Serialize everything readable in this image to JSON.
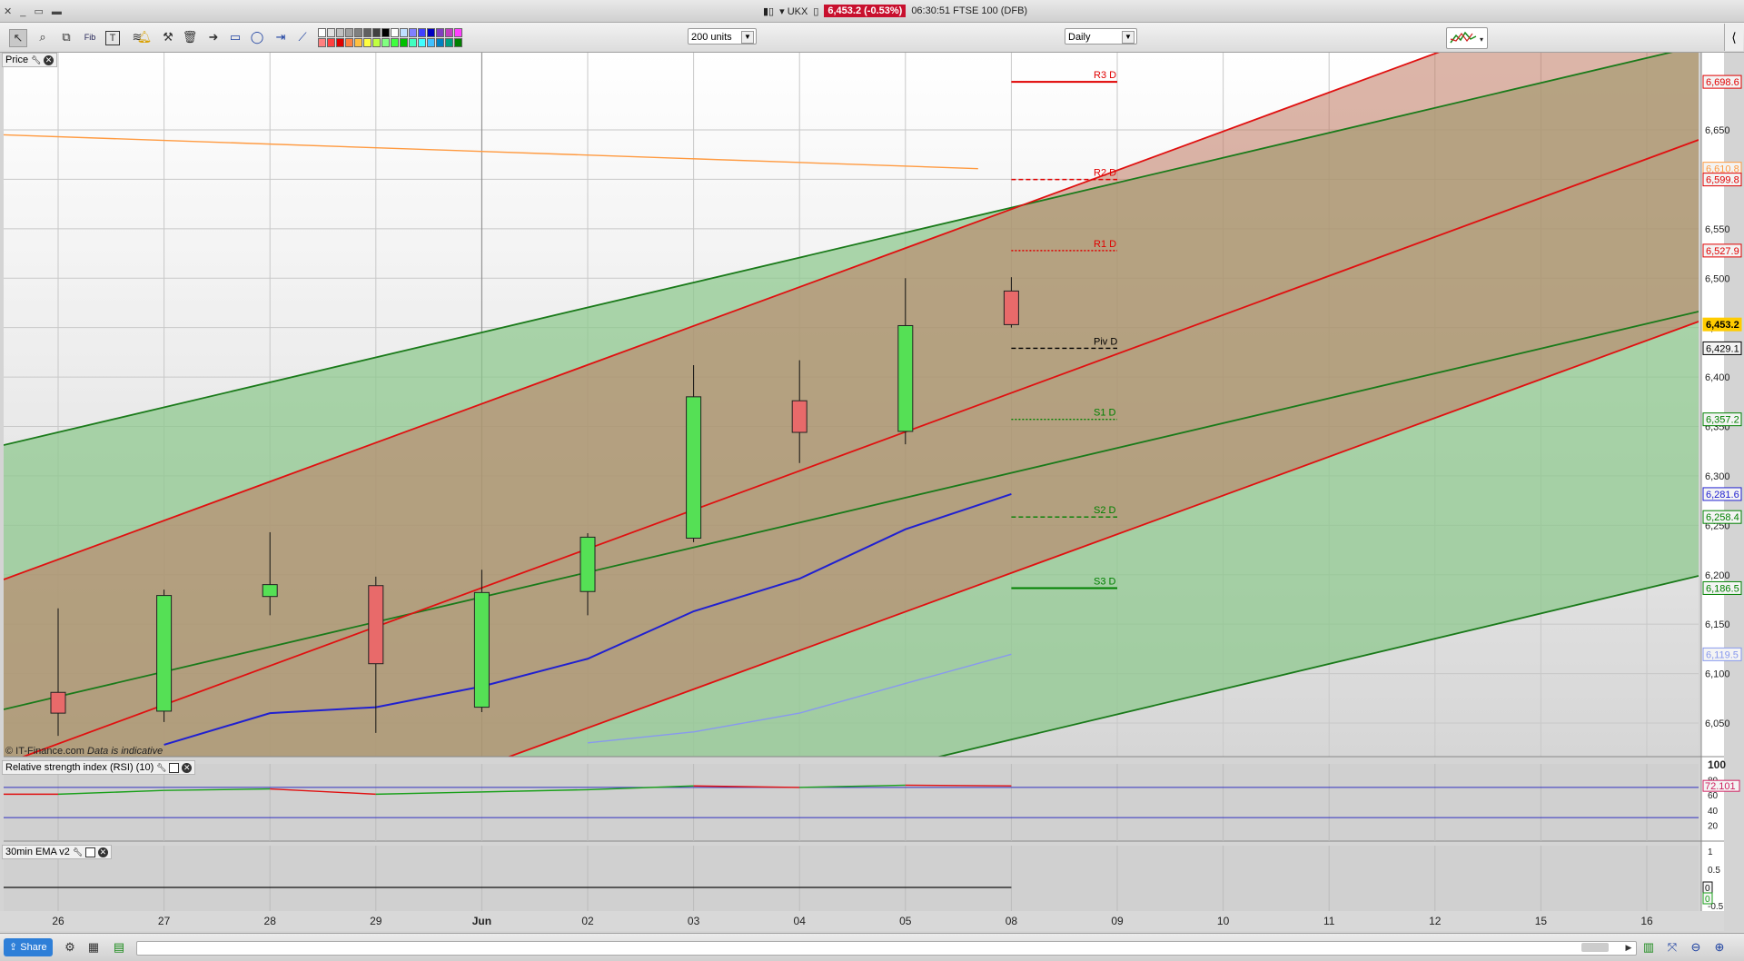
{
  "titlebar": {
    "symbol": "UKX",
    "price_badge": "6,453.2 (-0.53%)",
    "time_instrument": "06:30:51 FTSE 100 (DFB)"
  },
  "toolbar": {
    "units_select": "200 units",
    "interval_select": "Daily",
    "icons": [
      "pointer-icon",
      "zoom-icon",
      "indicator-icon",
      "fib-icon",
      "text-icon",
      "fib-retracement-icon",
      "alert-bell-icon",
      "magic-wand-icon",
      "trash-icon",
      "arrow-icon",
      "rectangle-icon",
      "ellipse-icon",
      "hline-icon",
      "trendline-icon"
    ],
    "swatch_colors": [
      "#ffffff",
      "#e0e0e0",
      "#c0c0c0",
      "#a0a0a0",
      "#808080",
      "#606060",
      "#404040",
      "#000000",
      "#ffffff",
      "#c0e0ff",
      "#8080ff",
      "#4040ff",
      "#0000c0",
      "#8040c0",
      "#c040c0",
      "#ff40ff",
      "#ff8080",
      "#ff4040",
      "#e00000",
      "#ff8040",
      "#ffc040",
      "#ffff40",
      "#c0ff40",
      "#80ff80",
      "#40ff40",
      "#00c000",
      "#40ffc0",
      "#40ffff",
      "#40c0ff",
      "#0080c0",
      "#00a080",
      "#008000"
    ]
  },
  "panels": {
    "price_label": "Price",
    "rsi_label": "Relative strength index (RSI) (10)",
    "ema_label": "30min EMA v2",
    "copyright": "© IT-Finance.com",
    "copyright_note": "Data is indicative"
  },
  "bottombar": {
    "share_label": "Share"
  },
  "chart_data": {
    "type": "candlestick",
    "x_labels": [
      "26",
      "27",
      "28",
      "29",
      "Jun",
      "02",
      "03",
      "04",
      "05",
      "08",
      "09",
      "10",
      "11",
      "12",
      "15",
      "16"
    ],
    "y_ticks": [
      6050,
      6100,
      6150,
      6200,
      6250,
      6300,
      6350,
      6400,
      6450,
      6500,
      6550,
      6600,
      6650
    ],
    "ylim": [
      6030,
      6745
    ],
    "candles": [
      {
        "x": "26",
        "open": 6081,
        "high": 6166,
        "low": 6037,
        "close": 6060,
        "color": "red"
      },
      {
        "x": "27",
        "open": 6062,
        "high": 6185,
        "low": 6051,
        "close": 6179,
        "color": "green"
      },
      {
        "x": "28",
        "open": 6178,
        "high": 6243,
        "low": 6159,
        "close": 6190,
        "color": "green"
      },
      {
        "x": "29",
        "open": 6189,
        "high": 6198,
        "low": 6040,
        "close": 6110,
        "color": "red"
      },
      {
        "x": "Jun",
        "open": 6066,
        "high": 6205,
        "low": 6061,
        "close": 6182,
        "color": "green"
      },
      {
        "x": "02",
        "open": 6183,
        "high": 6242,
        "low": 6159,
        "close": 6238,
        "color": "green"
      },
      {
        "x": "03",
        "open": 6237,
        "high": 6412,
        "low": 6233,
        "close": 6380,
        "color": "green"
      },
      {
        "x": "04",
        "open": 6376,
        "high": 6417,
        "low": 6313,
        "close": 6344,
        "color": "red"
      },
      {
        "x": "05",
        "open": 6345,
        "high": 6500,
        "low": 6332,
        "close": 6452,
        "color": "green"
      },
      {
        "x": "08",
        "open": 6487,
        "high": 6501,
        "low": 6450,
        "close": 6453,
        "color": "red"
      }
    ],
    "pivot_levels": [
      {
        "label": "R3 D",
        "value": 6698.6,
        "color": "#e00000",
        "style": "solid"
      },
      {
        "label": "R2 D",
        "value": 6599.8,
        "color": "#e00000",
        "style": "dashed"
      },
      {
        "label": "R1 D",
        "value": 6527.9,
        "color": "#e00000",
        "style": "dotted"
      },
      {
        "label": "Piv D",
        "value": 6429.1,
        "color": "#000000",
        "style": "dashed"
      },
      {
        "label": "S1 D",
        "value": 6357.2,
        "color": "#008000",
        "style": "dotted"
      },
      {
        "label": "S2 D",
        "value": 6258.4,
        "color": "#008000",
        "style": "dashed"
      },
      {
        "label": "S3 D",
        "value": 6186.5,
        "color": "#008000",
        "style": "solid"
      }
    ],
    "right_axis_markers": [
      {
        "value": "6,698.6",
        "color": "#e00000"
      },
      {
        "value": "6,610.8",
        "color": "#ff9a40"
      },
      {
        "value": "6,599.8",
        "color": "#e00000"
      },
      {
        "value": "6,527.9",
        "color": "#e00000"
      },
      {
        "value": "6,453.2",
        "color": "#ffcc00"
      },
      {
        "value": "6,429.1",
        "color": "#000000"
      },
      {
        "value": "6,357.2",
        "color": "#008000"
      },
      {
        "value": "6,281.6",
        "color": "#2020d0"
      },
      {
        "value": "6,258.4",
        "color": "#008000"
      },
      {
        "value": "6,186.5",
        "color": "#008000"
      },
      {
        "value": "6,119.5",
        "color": "#8899ee"
      }
    ],
    "moving_averages": [
      {
        "name": "",
        "color": "#2020d0",
        "points": [
          [
            "27",
            6028
          ],
          [
            "28",
            6060
          ],
          [
            "29",
            6066
          ],
          [
            "Jun",
            6087
          ],
          [
            "02",
            6115
          ],
          [
            "03",
            6163
          ],
          [
            "04",
            6196
          ],
          [
            "05",
            6246
          ],
          [
            "08",
            6281.6
          ]
        ]
      },
      {
        "name": "",
        "color": "#8899ee",
        "points": [
          [
            "02",
            6030
          ],
          [
            "03",
            6041
          ],
          [
            "04",
            6060
          ],
          [
            "05",
            6090
          ],
          [
            "08",
            6119.5
          ]
        ]
      }
    ],
    "orange_line": {
      "start": [
        "26",
        6645
      ],
      "end": [
        "05",
        6610.8
      ]
    },
    "rsi": {
      "ticks": [
        100,
        80,
        60,
        40,
        20
      ],
      "value": "72.101",
      "levels": [
        70,
        30
      ],
      "points": [
        [
          "26",
          61
        ],
        [
          "27",
          66
        ],
        [
          "28",
          68
        ],
        [
          "29",
          61
        ],
        [
          "Jun",
          64
        ],
        [
          "02",
          67
        ],
        [
          "03",
          72
        ],
        [
          "04",
          70
        ],
        [
          "05",
          73
        ],
        [
          "08",
          72.1
        ]
      ]
    },
    "ema_panel": {
      "ticks": [
        "1",
        "0.5",
        "0",
        "-0.5"
      ],
      "markers": [
        "0",
        "0"
      ]
    }
  }
}
